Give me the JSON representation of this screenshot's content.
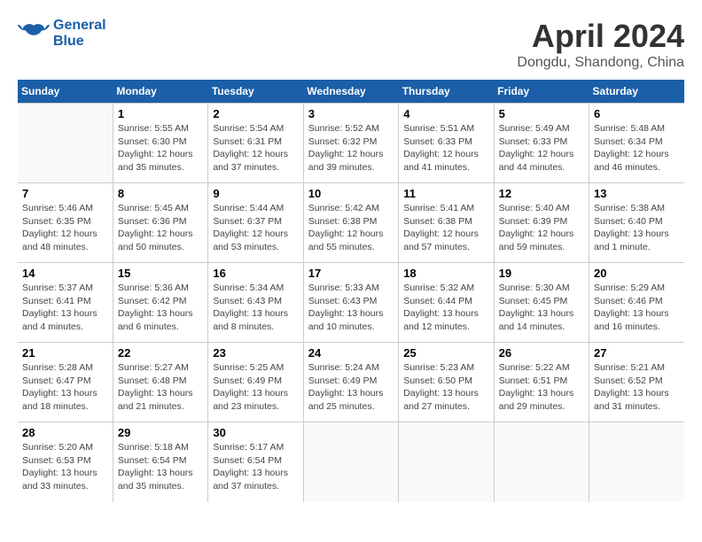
{
  "logo": {
    "line1": "General",
    "line2": "Blue"
  },
  "title": "April 2024",
  "location": "Dongdu, Shandong, China",
  "weekdays": [
    "Sunday",
    "Monday",
    "Tuesday",
    "Wednesday",
    "Thursday",
    "Friday",
    "Saturday"
  ],
  "weeks": [
    [
      {
        "day": "",
        "info": ""
      },
      {
        "day": "1",
        "info": "Sunrise: 5:55 AM\nSunset: 6:30 PM\nDaylight: 12 hours\nand 35 minutes."
      },
      {
        "day": "2",
        "info": "Sunrise: 5:54 AM\nSunset: 6:31 PM\nDaylight: 12 hours\nand 37 minutes."
      },
      {
        "day": "3",
        "info": "Sunrise: 5:52 AM\nSunset: 6:32 PM\nDaylight: 12 hours\nand 39 minutes."
      },
      {
        "day": "4",
        "info": "Sunrise: 5:51 AM\nSunset: 6:33 PM\nDaylight: 12 hours\nand 41 minutes."
      },
      {
        "day": "5",
        "info": "Sunrise: 5:49 AM\nSunset: 6:33 PM\nDaylight: 12 hours\nand 44 minutes."
      },
      {
        "day": "6",
        "info": "Sunrise: 5:48 AM\nSunset: 6:34 PM\nDaylight: 12 hours\nand 46 minutes."
      }
    ],
    [
      {
        "day": "7",
        "info": "Sunrise: 5:46 AM\nSunset: 6:35 PM\nDaylight: 12 hours\nand 48 minutes."
      },
      {
        "day": "8",
        "info": "Sunrise: 5:45 AM\nSunset: 6:36 PM\nDaylight: 12 hours\nand 50 minutes."
      },
      {
        "day": "9",
        "info": "Sunrise: 5:44 AM\nSunset: 6:37 PM\nDaylight: 12 hours\nand 53 minutes."
      },
      {
        "day": "10",
        "info": "Sunrise: 5:42 AM\nSunset: 6:38 PM\nDaylight: 12 hours\nand 55 minutes."
      },
      {
        "day": "11",
        "info": "Sunrise: 5:41 AM\nSunset: 6:38 PM\nDaylight: 12 hours\nand 57 minutes."
      },
      {
        "day": "12",
        "info": "Sunrise: 5:40 AM\nSunset: 6:39 PM\nDaylight: 12 hours\nand 59 minutes."
      },
      {
        "day": "13",
        "info": "Sunrise: 5:38 AM\nSunset: 6:40 PM\nDaylight: 13 hours\nand 1 minute."
      }
    ],
    [
      {
        "day": "14",
        "info": "Sunrise: 5:37 AM\nSunset: 6:41 PM\nDaylight: 13 hours\nand 4 minutes."
      },
      {
        "day": "15",
        "info": "Sunrise: 5:36 AM\nSunset: 6:42 PM\nDaylight: 13 hours\nand 6 minutes."
      },
      {
        "day": "16",
        "info": "Sunrise: 5:34 AM\nSunset: 6:43 PM\nDaylight: 13 hours\nand 8 minutes."
      },
      {
        "day": "17",
        "info": "Sunrise: 5:33 AM\nSunset: 6:43 PM\nDaylight: 13 hours\nand 10 minutes."
      },
      {
        "day": "18",
        "info": "Sunrise: 5:32 AM\nSunset: 6:44 PM\nDaylight: 13 hours\nand 12 minutes."
      },
      {
        "day": "19",
        "info": "Sunrise: 5:30 AM\nSunset: 6:45 PM\nDaylight: 13 hours\nand 14 minutes."
      },
      {
        "day": "20",
        "info": "Sunrise: 5:29 AM\nSunset: 6:46 PM\nDaylight: 13 hours\nand 16 minutes."
      }
    ],
    [
      {
        "day": "21",
        "info": "Sunrise: 5:28 AM\nSunset: 6:47 PM\nDaylight: 13 hours\nand 18 minutes."
      },
      {
        "day": "22",
        "info": "Sunrise: 5:27 AM\nSunset: 6:48 PM\nDaylight: 13 hours\nand 21 minutes."
      },
      {
        "day": "23",
        "info": "Sunrise: 5:25 AM\nSunset: 6:49 PM\nDaylight: 13 hours\nand 23 minutes."
      },
      {
        "day": "24",
        "info": "Sunrise: 5:24 AM\nSunset: 6:49 PM\nDaylight: 13 hours\nand 25 minutes."
      },
      {
        "day": "25",
        "info": "Sunrise: 5:23 AM\nSunset: 6:50 PM\nDaylight: 13 hours\nand 27 minutes."
      },
      {
        "day": "26",
        "info": "Sunrise: 5:22 AM\nSunset: 6:51 PM\nDaylight: 13 hours\nand 29 minutes."
      },
      {
        "day": "27",
        "info": "Sunrise: 5:21 AM\nSunset: 6:52 PM\nDaylight: 13 hours\nand 31 minutes."
      }
    ],
    [
      {
        "day": "28",
        "info": "Sunrise: 5:20 AM\nSunset: 6:53 PM\nDaylight: 13 hours\nand 33 minutes."
      },
      {
        "day": "29",
        "info": "Sunrise: 5:18 AM\nSunset: 6:54 PM\nDaylight: 13 hours\nand 35 minutes."
      },
      {
        "day": "30",
        "info": "Sunrise: 5:17 AM\nSunset: 6:54 PM\nDaylight: 13 hours\nand 37 minutes."
      },
      {
        "day": "",
        "info": ""
      },
      {
        "day": "",
        "info": ""
      },
      {
        "day": "",
        "info": ""
      },
      {
        "day": "",
        "info": ""
      }
    ]
  ]
}
